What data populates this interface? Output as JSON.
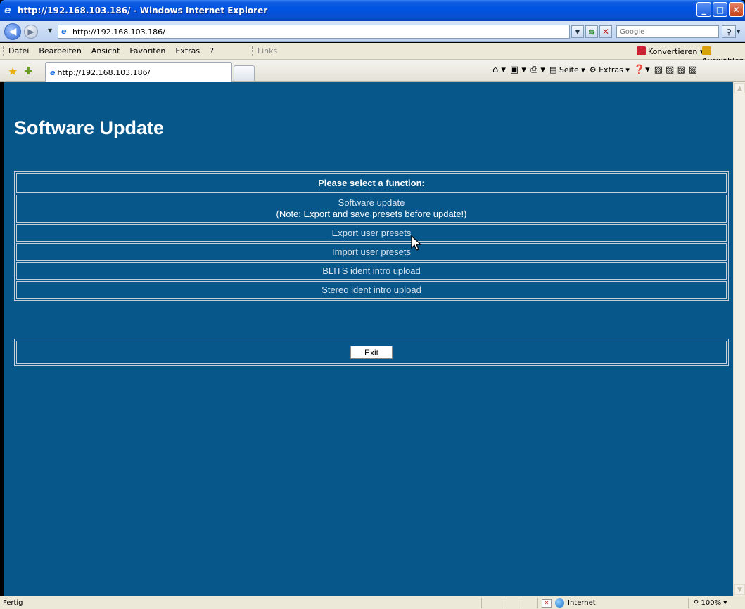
{
  "window": {
    "title": "http://192.168.103.186/ - Windows Internet Explorer",
    "buttons": [
      "minimize",
      "maximize",
      "close"
    ]
  },
  "address_bar": {
    "url": "http://192.168.103.186/",
    "search_placeholder": "Google"
  },
  "menu": {
    "items": [
      "Datei",
      "Bearbeiten",
      "Ansicht",
      "Favoriten",
      "Extras",
      "?"
    ],
    "links_label": "Links",
    "convert_label": "Konvertieren",
    "select_label": "Auswählen"
  },
  "tabs": {
    "active_tab": "http://192.168.103.186/"
  },
  "command_bar": {
    "page_label": "Seite",
    "tools_label": "Extras"
  },
  "page": {
    "title": "Software Update",
    "function_header": "Please select a function:",
    "functions": [
      {
        "label": "Software update",
        "note": "(Note: Export and save presets before update!)"
      },
      {
        "label": "Export user presets"
      },
      {
        "label": "Import user presets"
      },
      {
        "label": "BLITS ident intro upload"
      },
      {
        "label": "Stereo ident intro upload"
      }
    ],
    "exit_label": "Exit",
    "colors": {
      "background": "#07578b",
      "text": "#ffffff",
      "link": "#d9e3ec",
      "border": "#c5cfd9"
    }
  },
  "status_bar": {
    "status": "Fertig",
    "zone": "Internet",
    "zoom": "100%"
  }
}
